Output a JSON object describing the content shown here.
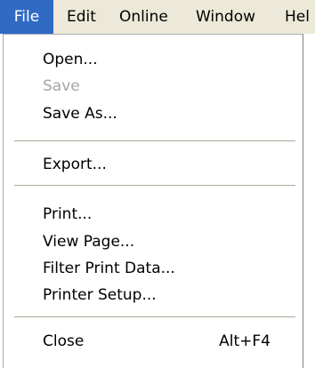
{
  "menubar": {
    "items": [
      {
        "label": "File",
        "active": true
      },
      {
        "label": "Edit",
        "active": false
      },
      {
        "label": "Online",
        "active": false
      },
      {
        "label": "Window",
        "active": false
      },
      {
        "label": "Hel",
        "active": false
      }
    ]
  },
  "file_menu": {
    "items": [
      {
        "label": "Open...",
        "enabled": true
      },
      {
        "label": "Save",
        "enabled": false
      },
      {
        "label": "Save As...",
        "enabled": true
      },
      {
        "label": "Export...",
        "enabled": true
      },
      {
        "label": "Print...",
        "enabled": true
      },
      {
        "label": "View Page...",
        "enabled": true
      },
      {
        "label": "Filter Print Data...",
        "enabled": true
      },
      {
        "label": "Printer Setup...",
        "enabled": true
      },
      {
        "label": "Close",
        "shortcut": "Alt+F4",
        "enabled": true
      }
    ]
  },
  "colors": {
    "menubar_bg": "#ece9d8",
    "highlight": "#316ac5",
    "disabled_text": "#a5a5a5",
    "separator": "#aca899"
  }
}
